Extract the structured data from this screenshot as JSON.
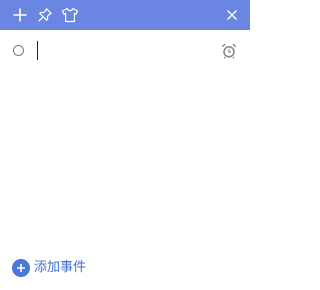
{
  "titlebar": {
    "background": "#6a86e2",
    "icons": [
      "plus-icon",
      "pin-icon",
      "shirt-icon",
      "close-icon"
    ]
  },
  "event_row": {
    "input_value": "",
    "alarm_icon": "alarm-clock-icon"
  },
  "footer": {
    "add_event_label": "添加事件",
    "accent": "#4a78d8"
  }
}
